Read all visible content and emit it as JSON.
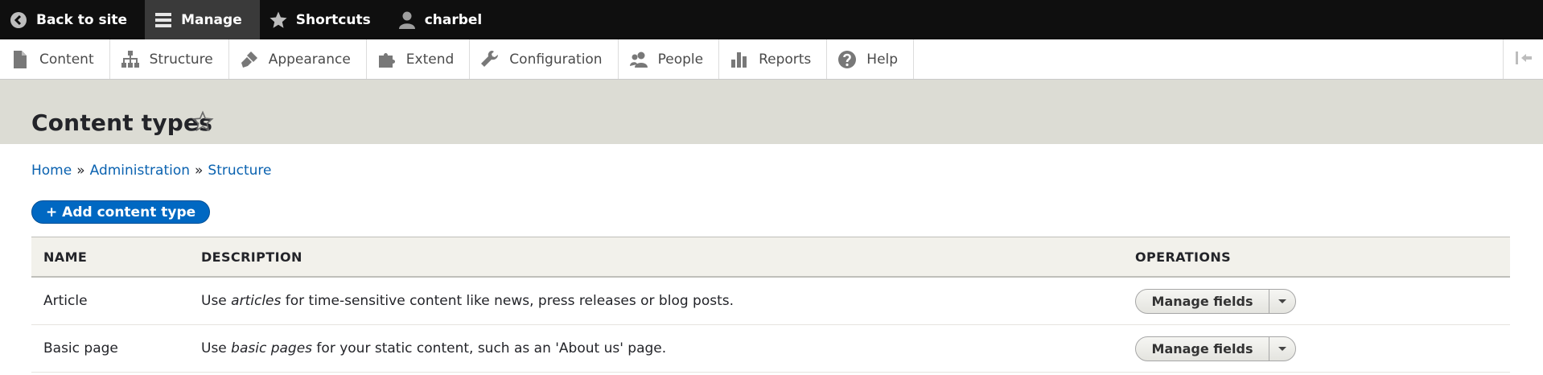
{
  "toolbar": {
    "back_label": "Back to site",
    "manage_label": "Manage",
    "shortcuts_label": "Shortcuts",
    "user_label": "charbel"
  },
  "tray": {
    "items": [
      {
        "label": "Content",
        "icon": "file-icon"
      },
      {
        "label": "Structure",
        "icon": "sitemap-icon"
      },
      {
        "label": "Appearance",
        "icon": "paintbrush-icon"
      },
      {
        "label": "Extend",
        "icon": "puzzle-icon"
      },
      {
        "label": "Configuration",
        "icon": "wrench-icon"
      },
      {
        "label": "People",
        "icon": "people-icon"
      },
      {
        "label": "Reports",
        "icon": "bar-chart-icon"
      },
      {
        "label": "Help",
        "icon": "help-icon"
      }
    ]
  },
  "page": {
    "title": "Content types"
  },
  "breadcrumb": {
    "items": [
      "Home",
      "Administration",
      "Structure"
    ],
    "separator": "»"
  },
  "actions": {
    "add_label": "+ Add content type"
  },
  "table": {
    "headers": [
      "NAME",
      "DESCRIPTION",
      "OPERATIONS"
    ],
    "rows": [
      {
        "name": "Article",
        "desc_before": "Use ",
        "desc_em": "articles",
        "desc_after": " for time-sensitive content like news, press releases or blog posts.",
        "operation": "Manage fields"
      },
      {
        "name": "Basic page",
        "desc_before": "Use ",
        "desc_em": "basic pages",
        "desc_after": " for your static content, such as an 'About us' page.",
        "operation": "Manage fields"
      }
    ]
  },
  "colors": {
    "toolbar_bg": "#0f0f0f",
    "header_bg": "#dcdcd4",
    "link": "#0a62b0",
    "primary_button": "#0068c2"
  }
}
